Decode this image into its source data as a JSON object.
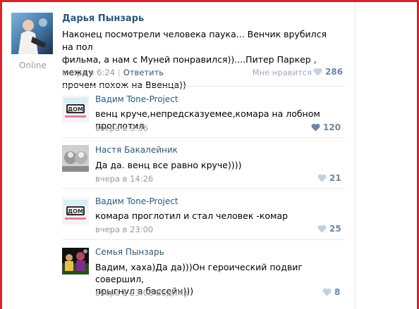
{
  "post": {
    "author": "Дарья Пынзарь",
    "status": "Online",
    "text_line1": "Наконец посмотрели человека паука... Венчик врубился на пол",
    "text_line2": "фильма, а нам с Муней понравился))....Питер Паркер , между",
    "text_line3": "прочем похож на Ввенца))",
    "date": "вчера в 6:24",
    "reply_label": "Ответить",
    "like_label": "Мне нравится",
    "likes": "286"
  },
  "comments": [
    {
      "author": "Вадим Tone-Project",
      "text": "венц круче,непредсказуемее,комара на лобном проглотил",
      "date": "вчера в 9:36",
      "likes": "120"
    },
    {
      "author": "Настя Бакалейник",
      "text": "Да да. венц все равно круче))))",
      "date": "вчера в 14:26",
      "likes": "21"
    },
    {
      "author": "Вадим Tone-Project",
      "text": "комара проглотил и стал человек -комар",
      "date": "вчера в 23:00",
      "likes": "25"
    },
    {
      "author": "Семья Пынзарь",
      "text_line1": "Вадим, хаха)Да да)))Он героический подвиг совершил,",
      "text_line2": "прыгнул в бассейн)))",
      "date": "вчера в 23:08 Вадиму",
      "likes": "8"
    }
  ],
  "colors": {
    "link": "#2b587a",
    "meta": "#999999",
    "like": "#6e86a2",
    "frame": "#d6242a"
  },
  "icons": {
    "like": "heart-icon",
    "dom_logo": "dom-logo"
  }
}
